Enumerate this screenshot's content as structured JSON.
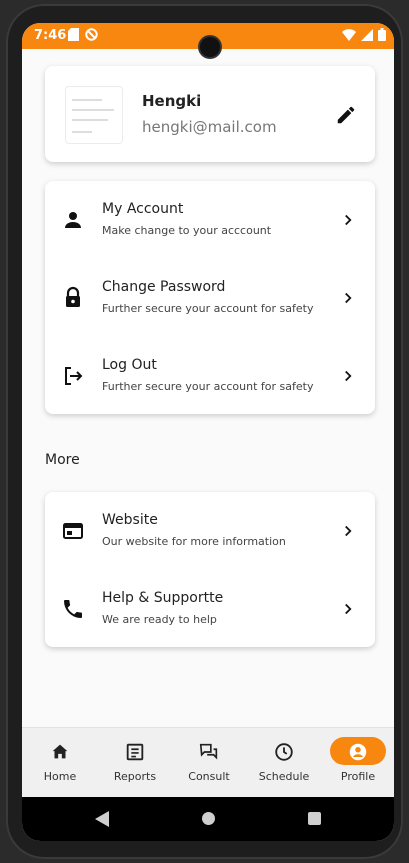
{
  "status_bar": {
    "time": "7:46",
    "background_color": "#f7870f",
    "left_icons": [
      "sd-card-icon",
      "do-not-disturb-icon"
    ],
    "right_icons": [
      "wifi-icon",
      "signal-icon",
      "battery-icon"
    ]
  },
  "profile": {
    "name": "Hengki",
    "email": "hengki@mail.com",
    "edit_icon": "pencil-icon"
  },
  "account_menu": [
    {
      "title": "My Account",
      "subtitle": "Make change to your acccount",
      "icon": "person-icon"
    },
    {
      "title": "Change Password",
      "subtitle": "Further secure your account for safety",
      "icon": "lock-icon"
    },
    {
      "title": "Log Out",
      "subtitle": "Further secure your account for safety",
      "icon": "logout-icon"
    }
  ],
  "more_section": {
    "heading": "More",
    "items": [
      {
        "title": "Website",
        "subtitle": "Our website for more information",
        "icon": "web-icon"
      },
      {
        "title": "Help & Supportte",
        "subtitle": "We are ready to help",
        "icon": "phone-icon"
      }
    ]
  },
  "bottom_nav": {
    "active_color": "#f7870f",
    "items": [
      {
        "label": "Home",
        "icon": "home-icon"
      },
      {
        "label": "Reports",
        "icon": "reports-icon"
      },
      {
        "label": "Consult",
        "icon": "chat-icon"
      },
      {
        "label": "Schedule",
        "icon": "clock-icon"
      },
      {
        "label": "Profile",
        "icon": "profile-icon",
        "active": true
      }
    ]
  }
}
